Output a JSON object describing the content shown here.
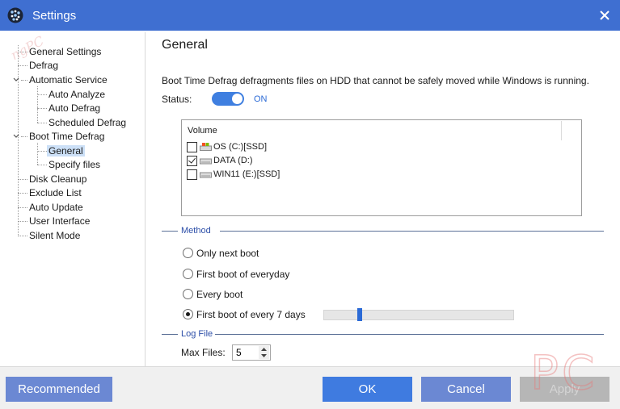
{
  "window": {
    "title": "Settings"
  },
  "watermark": "MajorGeeks.comPC",
  "tree": {
    "items": [
      {
        "label": "General Settings"
      },
      {
        "label": "Defrag"
      },
      {
        "label": "Automatic Service"
      },
      {
        "label": "Auto Analyze"
      },
      {
        "label": "Auto Defrag"
      },
      {
        "label": "Scheduled Defrag"
      },
      {
        "label": "Boot Time Defrag"
      },
      {
        "label": "General"
      },
      {
        "label": "Specify files"
      },
      {
        "label": "Disk Cleanup"
      },
      {
        "label": "Exclude List"
      },
      {
        "label": "Auto Update"
      },
      {
        "label": "User Interface"
      },
      {
        "label": "Silent Mode"
      }
    ],
    "selected": "General"
  },
  "panel": {
    "title": "General",
    "description": "Boot Time Defrag defragments files on HDD that cannot be safely moved while Windows is running.",
    "status_label": "Status:",
    "status_value": "ON",
    "volume_header": "Volume",
    "volumes": [
      {
        "label": "OS (C:)[SSD]",
        "checked": false
      },
      {
        "label": "DATA (D:)",
        "checked": true
      },
      {
        "label": "WIN11 (E:)[SSD]",
        "checked": false
      }
    ],
    "method_header": "Method",
    "methods": [
      {
        "label": "Only next boot",
        "checked": false
      },
      {
        "label": "First boot of everyday",
        "checked": false
      },
      {
        "label": "Every boot",
        "checked": false
      },
      {
        "label": "First boot of every 7 days",
        "checked": true
      }
    ],
    "days_slider_fraction": 0.18,
    "logfile_header": "Log File",
    "max_files_label": "Max Files:",
    "max_files_value": "5"
  },
  "footer": {
    "recommended": "Recommended",
    "ok": "OK",
    "cancel": "Cancel",
    "apply": "Apply"
  },
  "logo_text": "PC",
  "colors": {
    "titlebar": "#3f6fd1",
    "accent": "#2b6ad6",
    "secondary_button": "#6b88d3",
    "primary_button": "#3f7be0"
  }
}
